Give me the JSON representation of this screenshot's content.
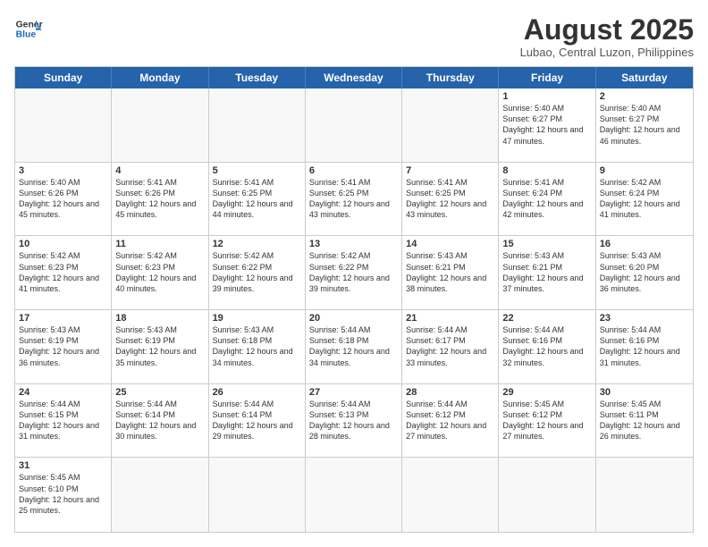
{
  "header": {
    "logo_general": "General",
    "logo_blue": "Blue",
    "month_year": "August 2025",
    "location": "Lubao, Central Luzon, Philippines"
  },
  "days_of_week": [
    "Sunday",
    "Monday",
    "Tuesday",
    "Wednesday",
    "Thursday",
    "Friday",
    "Saturday"
  ],
  "weeks": [
    [
      {
        "day": "",
        "info": ""
      },
      {
        "day": "",
        "info": ""
      },
      {
        "day": "",
        "info": ""
      },
      {
        "day": "",
        "info": ""
      },
      {
        "day": "",
        "info": ""
      },
      {
        "day": "1",
        "info": "Sunrise: 5:40 AM\nSunset: 6:27 PM\nDaylight: 12 hours\nand 47 minutes."
      },
      {
        "day": "2",
        "info": "Sunrise: 5:40 AM\nSunset: 6:27 PM\nDaylight: 12 hours\nand 46 minutes."
      }
    ],
    [
      {
        "day": "3",
        "info": "Sunrise: 5:40 AM\nSunset: 6:26 PM\nDaylight: 12 hours\nand 45 minutes."
      },
      {
        "day": "4",
        "info": "Sunrise: 5:41 AM\nSunset: 6:26 PM\nDaylight: 12 hours\nand 45 minutes."
      },
      {
        "day": "5",
        "info": "Sunrise: 5:41 AM\nSunset: 6:25 PM\nDaylight: 12 hours\nand 44 minutes."
      },
      {
        "day": "6",
        "info": "Sunrise: 5:41 AM\nSunset: 6:25 PM\nDaylight: 12 hours\nand 43 minutes."
      },
      {
        "day": "7",
        "info": "Sunrise: 5:41 AM\nSunset: 6:25 PM\nDaylight: 12 hours\nand 43 minutes."
      },
      {
        "day": "8",
        "info": "Sunrise: 5:41 AM\nSunset: 6:24 PM\nDaylight: 12 hours\nand 42 minutes."
      },
      {
        "day": "9",
        "info": "Sunrise: 5:42 AM\nSunset: 6:24 PM\nDaylight: 12 hours\nand 41 minutes."
      }
    ],
    [
      {
        "day": "10",
        "info": "Sunrise: 5:42 AM\nSunset: 6:23 PM\nDaylight: 12 hours\nand 41 minutes."
      },
      {
        "day": "11",
        "info": "Sunrise: 5:42 AM\nSunset: 6:23 PM\nDaylight: 12 hours\nand 40 minutes."
      },
      {
        "day": "12",
        "info": "Sunrise: 5:42 AM\nSunset: 6:22 PM\nDaylight: 12 hours\nand 39 minutes."
      },
      {
        "day": "13",
        "info": "Sunrise: 5:42 AM\nSunset: 6:22 PM\nDaylight: 12 hours\nand 39 minutes."
      },
      {
        "day": "14",
        "info": "Sunrise: 5:43 AM\nSunset: 6:21 PM\nDaylight: 12 hours\nand 38 minutes."
      },
      {
        "day": "15",
        "info": "Sunrise: 5:43 AM\nSunset: 6:21 PM\nDaylight: 12 hours\nand 37 minutes."
      },
      {
        "day": "16",
        "info": "Sunrise: 5:43 AM\nSunset: 6:20 PM\nDaylight: 12 hours\nand 36 minutes."
      }
    ],
    [
      {
        "day": "17",
        "info": "Sunrise: 5:43 AM\nSunset: 6:19 PM\nDaylight: 12 hours\nand 36 minutes."
      },
      {
        "day": "18",
        "info": "Sunrise: 5:43 AM\nSunset: 6:19 PM\nDaylight: 12 hours\nand 35 minutes."
      },
      {
        "day": "19",
        "info": "Sunrise: 5:43 AM\nSunset: 6:18 PM\nDaylight: 12 hours\nand 34 minutes."
      },
      {
        "day": "20",
        "info": "Sunrise: 5:44 AM\nSunset: 6:18 PM\nDaylight: 12 hours\nand 34 minutes."
      },
      {
        "day": "21",
        "info": "Sunrise: 5:44 AM\nSunset: 6:17 PM\nDaylight: 12 hours\nand 33 minutes."
      },
      {
        "day": "22",
        "info": "Sunrise: 5:44 AM\nSunset: 6:16 PM\nDaylight: 12 hours\nand 32 minutes."
      },
      {
        "day": "23",
        "info": "Sunrise: 5:44 AM\nSunset: 6:16 PM\nDaylight: 12 hours\nand 31 minutes."
      }
    ],
    [
      {
        "day": "24",
        "info": "Sunrise: 5:44 AM\nSunset: 6:15 PM\nDaylight: 12 hours\nand 31 minutes."
      },
      {
        "day": "25",
        "info": "Sunrise: 5:44 AM\nSunset: 6:14 PM\nDaylight: 12 hours\nand 30 minutes."
      },
      {
        "day": "26",
        "info": "Sunrise: 5:44 AM\nSunset: 6:14 PM\nDaylight: 12 hours\nand 29 minutes."
      },
      {
        "day": "27",
        "info": "Sunrise: 5:44 AM\nSunset: 6:13 PM\nDaylight: 12 hours\nand 28 minutes."
      },
      {
        "day": "28",
        "info": "Sunrise: 5:44 AM\nSunset: 6:12 PM\nDaylight: 12 hours\nand 27 minutes."
      },
      {
        "day": "29",
        "info": "Sunrise: 5:45 AM\nSunset: 6:12 PM\nDaylight: 12 hours\nand 27 minutes."
      },
      {
        "day": "30",
        "info": "Sunrise: 5:45 AM\nSunset: 6:11 PM\nDaylight: 12 hours\nand 26 minutes."
      }
    ],
    [
      {
        "day": "31",
        "info": "Sunrise: 5:45 AM\nSunset: 6:10 PM\nDaylight: 12 hours\nand 25 minutes."
      },
      {
        "day": "",
        "info": ""
      },
      {
        "day": "",
        "info": ""
      },
      {
        "day": "",
        "info": ""
      },
      {
        "day": "",
        "info": ""
      },
      {
        "day": "",
        "info": ""
      },
      {
        "day": "",
        "info": ""
      }
    ]
  ]
}
